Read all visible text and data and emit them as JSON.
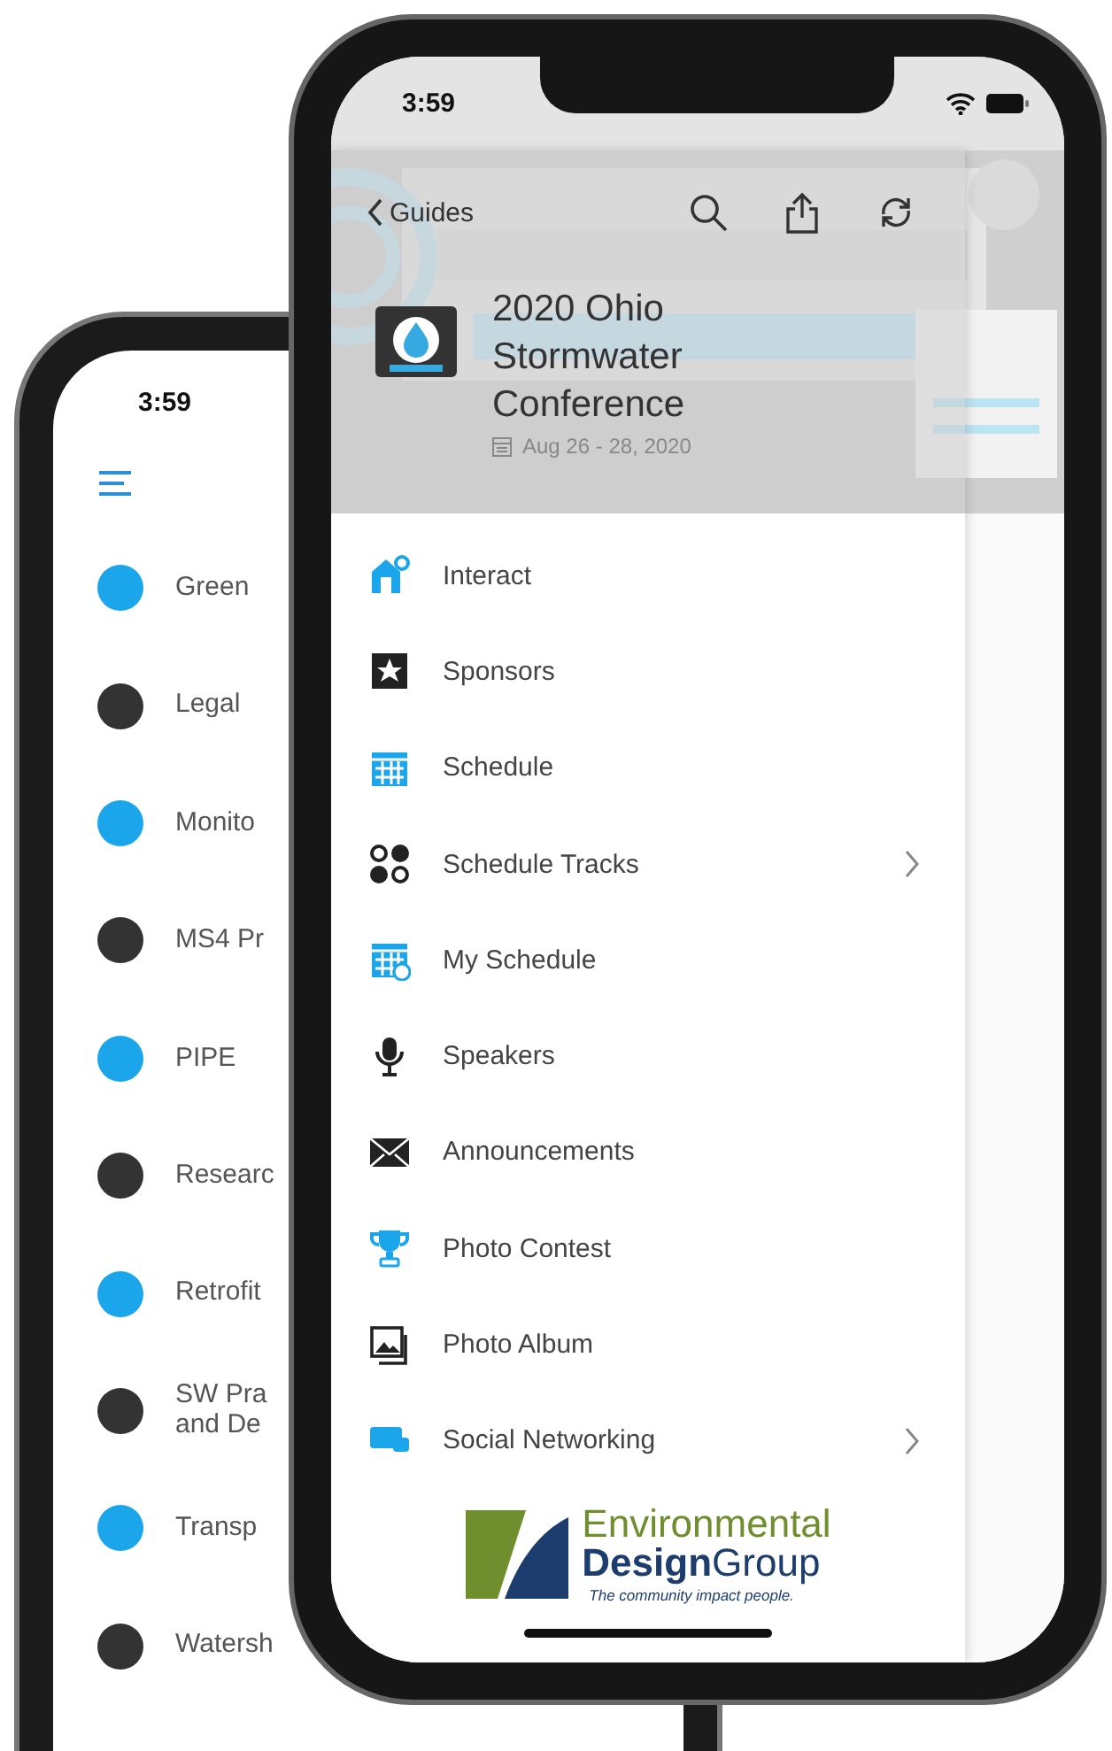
{
  "back_phone": {
    "status_time": "3:59",
    "tracks": [
      {
        "label": "Green",
        "color": "#1ba6ec"
      },
      {
        "label": "Legal",
        "color": "#333333"
      },
      {
        "label": "Monito",
        "color": "#1ba6ec"
      },
      {
        "label": "MS4 Pr",
        "color": "#333333"
      },
      {
        "label": "PIPE",
        "color": "#1ba6ec"
      },
      {
        "label": "Researc",
        "color": "#333333"
      },
      {
        "label": "Retrofit",
        "color": "#1ba6ec"
      },
      {
        "label": "SW Pra\nand De",
        "color": "#333333"
      },
      {
        "label": "Transp",
        "color": "#1ba6ec"
      },
      {
        "label": "Watersh",
        "color": "#333333"
      }
    ]
  },
  "front_phone": {
    "status_time": "3:59",
    "nav": {
      "back_label": "Guides"
    },
    "event": {
      "title": "2020 Ohio Stormwater Conference",
      "dates": "Aug 26 - 28, 2020"
    },
    "menu": [
      {
        "label": "Interact",
        "submenu": false
      },
      {
        "label": "Sponsors",
        "submenu": false
      },
      {
        "label": "Schedule",
        "submenu": false
      },
      {
        "label": "Schedule Tracks",
        "submenu": true
      },
      {
        "label": "My Schedule",
        "submenu": false
      },
      {
        "label": "Speakers",
        "submenu": false
      },
      {
        "label": "Announcements",
        "submenu": false
      },
      {
        "label": "Photo Contest",
        "submenu": false
      },
      {
        "label": "Photo Album",
        "submenu": false
      },
      {
        "label": "Social Networking",
        "submenu": true
      }
    ],
    "sponsor": {
      "name": "Environmental",
      "name_2": "**Design**Group",
      "tagline": "The community impact people."
    }
  }
}
